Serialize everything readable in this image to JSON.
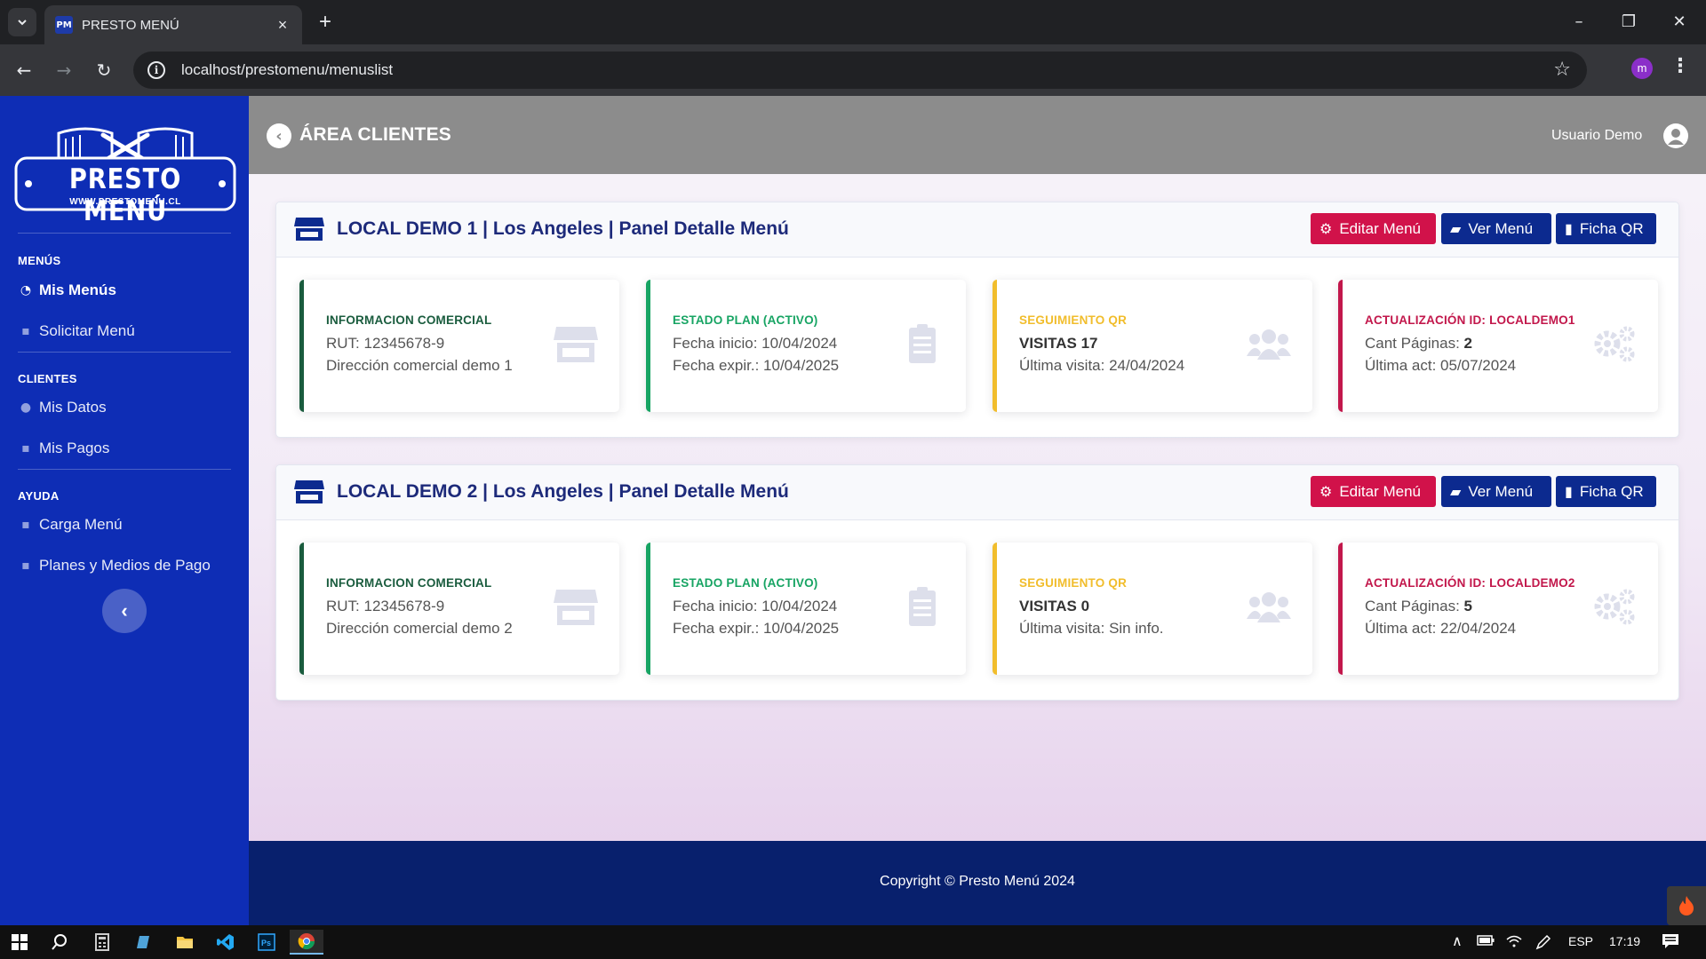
{
  "browser": {
    "tab_title": "PRESTO MENÚ",
    "favicon_text": "PM",
    "url": "localhost/prestomenu/menuslist",
    "profile_initial": "m"
  },
  "brand": {
    "logo_title": "PRESTO MENÚ",
    "logo_url": "WWW.PRESTOMENU.CL"
  },
  "sidebar": {
    "sections": [
      {
        "heading": "MENÚS",
        "items": [
          {
            "label": "Mis Menús",
            "icon": "dashboard-icon",
            "active": true
          },
          {
            "label": "Solicitar Menú",
            "icon": "file-plus-icon"
          }
        ]
      },
      {
        "heading": "CLIENTES",
        "items": [
          {
            "label": "Mis Datos",
            "icon": "user-icon"
          },
          {
            "label": "Mis Pagos",
            "icon": "clipboard-icon"
          }
        ]
      },
      {
        "heading": "AYUDA",
        "items": [
          {
            "label": "Carga Menú",
            "icon": "clipboard-icon"
          },
          {
            "label": "Planes y Medios de Pago",
            "icon": "clipboard-icon"
          }
        ]
      }
    ]
  },
  "header": {
    "title": "ÁREA CLIENTES",
    "user_name": "Usuario Demo"
  },
  "buttons": {
    "edit": "Editar Menú",
    "view": "Ver Menú",
    "qr": "Ficha QR"
  },
  "locals": [
    {
      "title": "LOCAL DEMO 1 | Los Angeles | Panel Detalle Menú",
      "cards": [
        {
          "label": "INFORMACION COMERCIAL",
          "line1": "RUT: 12345678-9",
          "line2": "Dirección comercial demo 1",
          "icon": "store-icon",
          "color": "#1a5c3e"
        },
        {
          "label": "ESTADO PLAN (ACTIVO)",
          "line1": "Fecha inicio: 10/04/2024",
          "line2": "Fecha expir.: 10/04/2025",
          "icon": "clipboard-list-icon",
          "color": "#17a463"
        },
        {
          "label": "SEGUIMIENTO QR",
          "line1_strong": "VISITAS 17",
          "line2": "Última visita: 24/04/2024",
          "icon": "users-icon",
          "color": "#f1bd2c"
        },
        {
          "label": "ACTUALIZACIÓN ID: LOCALDEMO1",
          "line1": "Cant Páginas: ",
          "line1_value": "2",
          "line2": "Última act: 05/07/2024",
          "icon": "cogs-icon",
          "color": "#c2174b"
        }
      ]
    },
    {
      "title": "LOCAL DEMO 2 | Los Angeles | Panel Detalle Menú",
      "cards": [
        {
          "label": "INFORMACION COMERCIAL",
          "line1": "RUT: 12345678-9",
          "line2": "Dirección comercial demo 2",
          "icon": "store-icon",
          "color": "#1a5c3e"
        },
        {
          "label": "ESTADO PLAN (ACTIVO)",
          "line1": "Fecha inicio: 10/04/2024",
          "line2": "Fecha expir.: 10/04/2025",
          "icon": "clipboard-list-icon",
          "color": "#17a463"
        },
        {
          "label": "SEGUIMIENTO QR",
          "line1_strong": "VISITAS 0",
          "line2": "Última visita: Sin info.",
          "icon": "users-icon",
          "color": "#f1bd2c"
        },
        {
          "label": "ACTUALIZACIÓN ID: LOCALDEMO2",
          "line1": "Cant Páginas: ",
          "line1_value": "5",
          "line2": "Última act: 22/04/2024",
          "icon": "cogs-icon",
          "color": "#c2174b"
        }
      ]
    }
  ],
  "footer": {
    "copyright": "Copyright © Presto Menú 2024"
  },
  "taskbar": {
    "language": "ESP",
    "time": "17:19"
  }
}
